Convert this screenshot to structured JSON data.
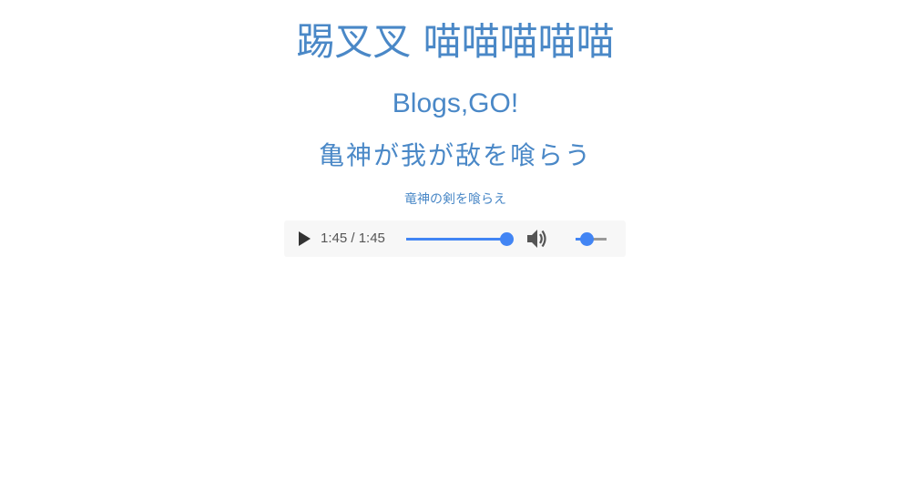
{
  "header": {
    "title": "踢叉叉 喵喵喵喵喵",
    "subtitle": "Blogs,GO!",
    "line3": "亀神が我が敌を喰らう",
    "line4": "竜神の剣を喰らえ"
  },
  "player": {
    "time_text": "1:45 / 1:45",
    "progress_fraction": 1.0,
    "volume_fraction": 0.35,
    "accent_color": "#4285f4",
    "play_icon": "play-icon",
    "volume_icon": "speaker-icon"
  }
}
